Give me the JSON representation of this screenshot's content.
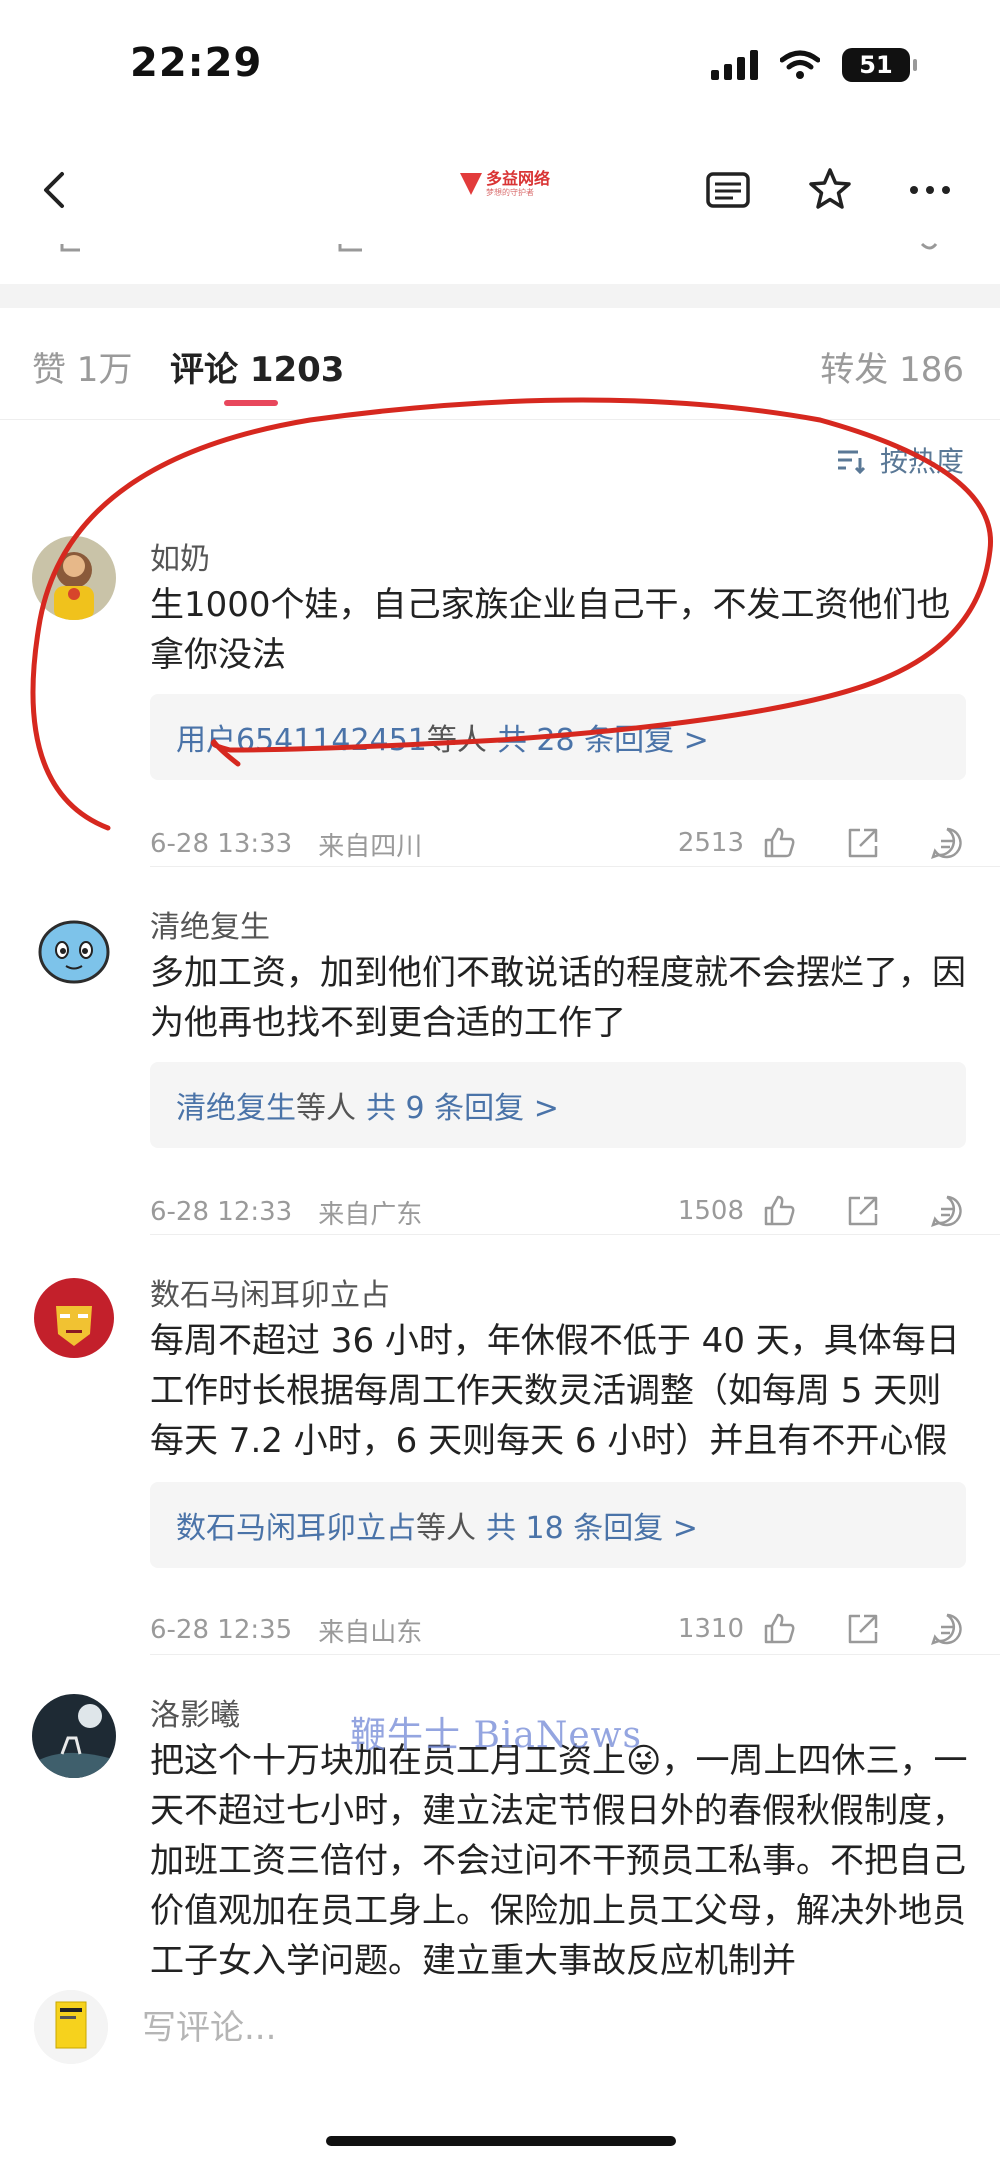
{
  "status_bar": {
    "time": "22:29",
    "battery": "51"
  },
  "nav": {
    "logo_name": "多益网络",
    "logo_sub": "梦想的守护者"
  },
  "tabs": {
    "likes": "赞 1万",
    "comments": "评论 1203",
    "shares": "转发 186"
  },
  "sort": {
    "label": "按热度"
  },
  "comments": [
    {
      "name": "如奶",
      "text": "生1000个娃，自己家族企业自己干，不发工资他们也拿你没法",
      "reply_user": "用户6541142451",
      "reply_mid": "等人",
      "reply_count": "共 28 条回复 >",
      "date": "6-28 13:33",
      "location": "来自四川",
      "likes": "2513"
    },
    {
      "name": "清绝复生",
      "text": "多加工资，加到他们不敢说话的程度就不会摆烂了，因为他再也找不到更合适的工作了",
      "reply_user": "清绝复生",
      "reply_mid": "等人",
      "reply_count": "共 9 条回复 >",
      "date": "6-28 12:33",
      "location": "来自广东",
      "likes": "1508"
    },
    {
      "name": "数石马闲耳卯立占",
      "text": "每周不超过 36 小时，年休假不低于 40 天，具体每日工作时长根据每周工作天数灵活调整（如每周 5 天则每天 7.2 小时，6 天则每天 6 小时）并且有不开心假",
      "reply_user": "数石马闲耳卯立占",
      "reply_mid": "等人",
      "reply_count": "共 18 条回复 >",
      "date": "6-28 12:35",
      "location": "来自山东",
      "likes": "1310"
    },
    {
      "name": "洛影曦",
      "text": "把这个十万块加在员工月工资上😜，一周上四休三，一天不超过七小时，建立法定节假日外的春假秋假制度，加班工资三倍付，不会过问不干预员工私事。不把自己价值观加在员工身上。保险加上员工父母，解决外地员工子女入学问题。建立重大事故反应机制并"
    }
  ],
  "watermark": "鞭牛士 BiaNews",
  "bottom": {
    "placeholder": "写评论..."
  },
  "colors": {
    "accent": "#e8475c",
    "link": "#4a73a8",
    "annotation": "#d6281f"
  }
}
